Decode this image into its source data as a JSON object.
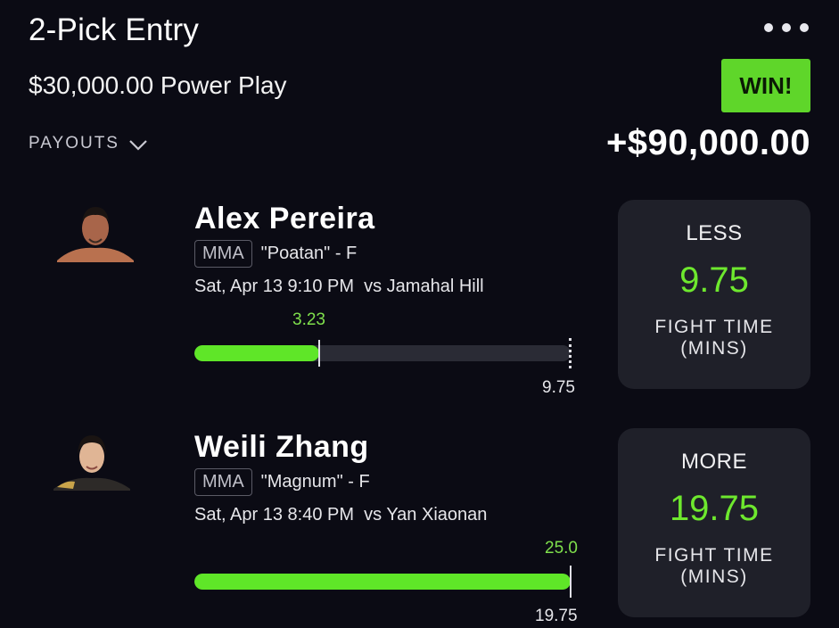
{
  "header": {
    "title": "2-Pick Entry",
    "subtitle": "$30,000.00 Power Play",
    "more_icon": "ellipsis-icon",
    "result_badge": "WIN!",
    "payouts_label": "PAYOUTS",
    "winnings": "+$90,000.00"
  },
  "colors": {
    "accent": "#5fe628",
    "background": "#0b0b14",
    "card": "#1f2029"
  },
  "picks": [
    {
      "name": "Alex Pereira",
      "league": "MMA",
      "nickname": "\"Poatan\" - F",
      "date_time": "Sat, Apr 13 9:10 PM",
      "opponent": "vs Jamahal Hill",
      "actual": "3.23",
      "line": "9.75",
      "direction": "LESS",
      "stat_line1": "FIGHT TIME",
      "stat_line2": "(MINS)",
      "progress_fraction": 0.331
    },
    {
      "name": "Weili Zhang",
      "league": "MMA",
      "nickname": "\"Magnum\" - F",
      "date_time": "Sat, Apr 13 8:40 PM",
      "opponent": "vs Yan Xiaonan",
      "actual": "25.0",
      "line": "19.75",
      "direction": "MORE",
      "stat_line1": "FIGHT TIME",
      "stat_line2": "(MINS)",
      "progress_fraction": 1.0
    }
  ]
}
